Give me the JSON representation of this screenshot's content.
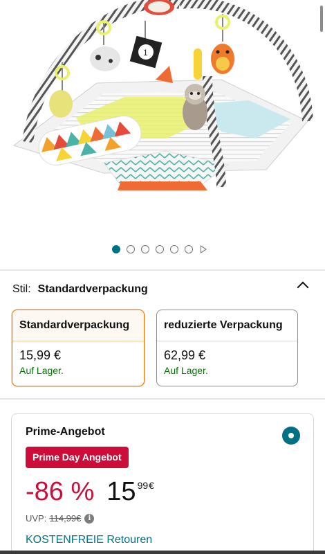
{
  "gallery": {
    "image_alt": "Spielbogen / Krabbeldecke mit Faultier und Spielzeugen",
    "image_number_tag": "1",
    "image_count": 6,
    "active_index": 0
  },
  "style_selector": {
    "label": "Stil:",
    "selected_value": "Standardverpackung",
    "options": [
      {
        "title": "Standardverpackung",
        "price": "15,99 €",
        "stock": "Auf Lager.",
        "selected": true
      },
      {
        "title": "reduzierte Verpackung",
        "price": "62,99 €",
        "stock": "Auf Lager.",
        "selected": false
      }
    ]
  },
  "offer": {
    "title": "Prime-Angebot",
    "badge": "Prime Day Angebot",
    "discount": "-86 %",
    "price_whole": "15",
    "price_cents": "99",
    "currency": "€",
    "uvp_label": "UVP:",
    "uvp_value": "114,99€",
    "info_icon": "i",
    "returns_link": "KOSTENFREIE Retouren"
  },
  "colors": {
    "accent": "#007185",
    "deal_red": "#cc0c39",
    "in_stock_green": "#007600",
    "selected_border": "#e77600"
  }
}
